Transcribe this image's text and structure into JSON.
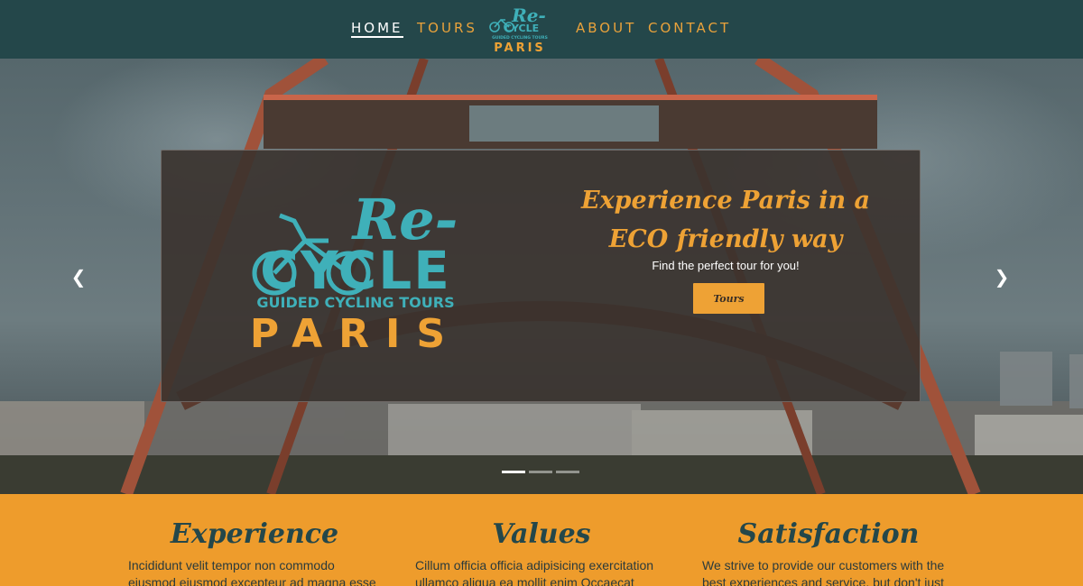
{
  "nav": {
    "items": [
      {
        "label": "HOME",
        "active": true
      },
      {
        "label": "TOURS",
        "active": false
      },
      {
        "label": "ABOUT",
        "active": false
      },
      {
        "label": "CONTACT",
        "active": false
      }
    ],
    "logo": {
      "line1": "Re-",
      "line2": "CYCLE",
      "line3": "GUIDED CYCLING TOURS",
      "line4": "PARIS"
    }
  },
  "hero": {
    "headline": "Experience Paris in a ECO friendly way",
    "subline": "Find the perfect tour for you!",
    "button_label": "Tours",
    "logo": {
      "line1": "Re-",
      "line2": "CYCLE",
      "line3": "GUIDED CYCLING TOURS",
      "line4": "PARIS"
    },
    "prev_icon": "chevron-left-icon",
    "next_icon": "chevron-right-icon",
    "slides": 3,
    "active_slide": 1
  },
  "features": [
    {
      "title": "Experience",
      "text": "Incididunt velit tempor non commodo eiusmod eiusmod excepteur ad magna esse"
    },
    {
      "title": "Values",
      "text": "Cillum officia officia adipisicing exercitation ullamco aliqua ea mollit enim Occaecat fugiat"
    },
    {
      "title": "Satisfaction",
      "text": "We strive to provide our customers with the best experiences and service, but don't just"
    }
  ],
  "colors": {
    "nav_bg": "#24474a",
    "accent": "#eea235",
    "teal": "#3fb0b9",
    "features_bg": "#ee9c2c"
  }
}
